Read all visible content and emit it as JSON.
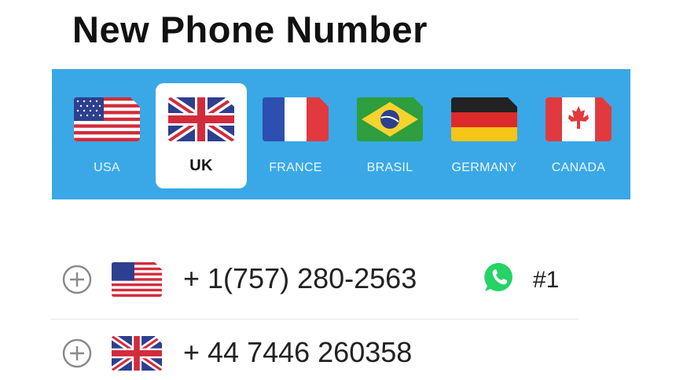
{
  "header": {
    "title": "New Phone Number"
  },
  "countries": [
    {
      "label": "USA",
      "flag": "us-flag",
      "selected": false
    },
    {
      "label": "UK",
      "flag": "uk-flag",
      "selected": true
    },
    {
      "label": "FRANCE",
      "flag": "france-flag",
      "selected": false
    },
    {
      "label": "BRASIL",
      "flag": "brazil-flag",
      "selected": false
    },
    {
      "label": "GERMANY",
      "flag": "germany-flag",
      "selected": false
    },
    {
      "label": "CANADA",
      "flag": "canada-flag",
      "selected": false
    }
  ],
  "numbers": [
    {
      "flag": "us-flag",
      "number": "+ 1(757) 280-2563",
      "app_icon": "whatsapp-icon",
      "rank": "#1"
    },
    {
      "flag": "uk-flag",
      "number": "+ 44 7446 260358"
    }
  ],
  "colors": {
    "accent_bar": "#3aa8e6",
    "whatsapp": "#25d366"
  }
}
